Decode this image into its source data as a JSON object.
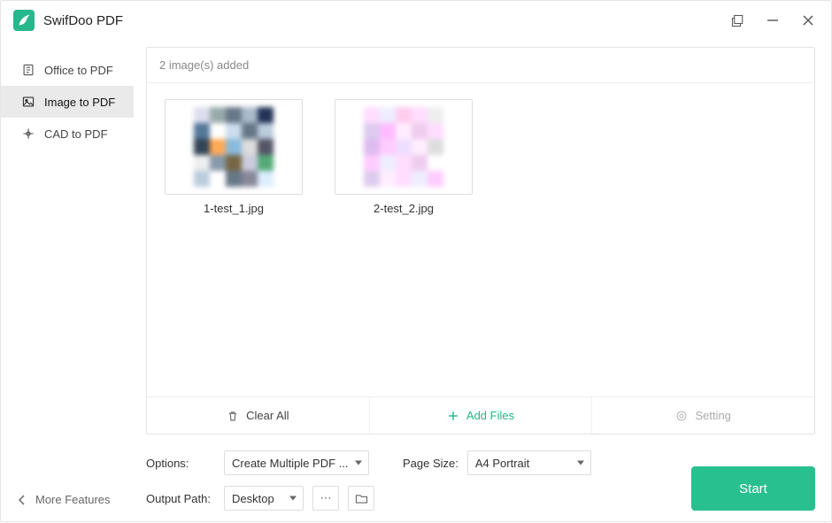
{
  "app": {
    "title": "SwifDoo PDF"
  },
  "sidebar": {
    "items": [
      {
        "label": "Office to PDF",
        "icon": "office-icon"
      },
      {
        "label": "Image to PDF",
        "icon": "image-icon"
      },
      {
        "label": "CAD to PDF",
        "icon": "cad-icon"
      }
    ],
    "active_index": 1
  },
  "header": {
    "status": "2 image(s) added"
  },
  "thumbs": [
    {
      "name": "1-test_1.jpg"
    },
    {
      "name": "2-test_2.jpg"
    }
  ],
  "panel_footer": {
    "clear": "Clear All",
    "add": "Add Files",
    "setting": "Setting"
  },
  "options": {
    "label": "Options:",
    "value": "Create Multiple PDF ..."
  },
  "page_size": {
    "label": "Page Size:",
    "value": "A4 Portrait"
  },
  "output": {
    "label": "Output Path:",
    "value": "Desktop"
  },
  "buttons": {
    "start": "Start",
    "more": "More Features"
  }
}
